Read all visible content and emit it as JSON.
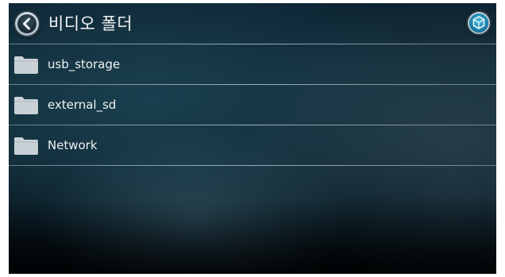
{
  "header": {
    "title": "비디오 폴더",
    "back_icon": "chevron-left-icon",
    "menu_icon": "hexagon-cube-icon"
  },
  "folders": [
    {
      "label": "usb_storage",
      "icon": "folder-icon"
    },
    {
      "label": "external_sd",
      "icon": "folder-icon"
    },
    {
      "label": "Network",
      "icon": "folder-icon"
    }
  ],
  "colors": {
    "background": "#112b38",
    "text": "#eef2f4",
    "folder": "#c9d1d6",
    "accent": "#1b7fa8"
  }
}
